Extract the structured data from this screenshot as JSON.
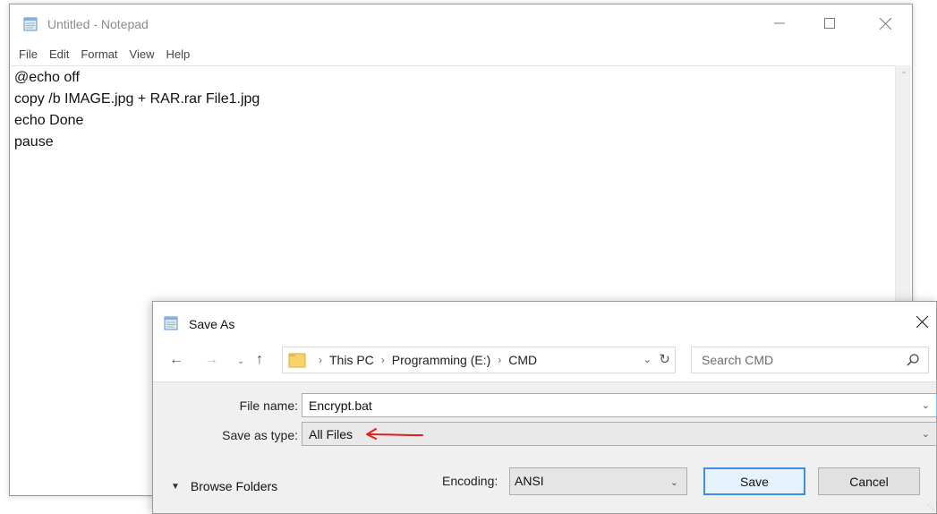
{
  "notepad": {
    "title": "Untitled - Notepad",
    "menu": [
      "File",
      "Edit",
      "Format",
      "View",
      "Help"
    ],
    "lines": [
      "@echo off",
      "copy /b IMAGE.jpg + RAR.rar File1.jpg",
      "echo Done",
      "pause"
    ]
  },
  "dialog": {
    "title": "Save As",
    "breadcrumb": [
      "This PC",
      "Programming (E:)",
      "CMD"
    ],
    "search_placeholder": "Search CMD",
    "file_name_label": "File name:",
    "file_name_value": "Encrypt.bat",
    "save_type_label": "Save as type:",
    "save_type_value": "All Files",
    "browse_folders_label": "Browse Folders",
    "encoding_label": "Encoding:",
    "encoding_value": "ANSI",
    "save_label": "Save",
    "cancel_label": "Cancel"
  },
  "icons": {
    "notepad_icon": "notepad-icon",
    "folder_icon": "folder-icon",
    "search_icon": "search-icon",
    "annotation": "red-arrow-annotation"
  },
  "colors": {
    "accent": "#3c8ee0",
    "annotation_red": "#e02020",
    "folder_yellow": "#f6d36b"
  }
}
